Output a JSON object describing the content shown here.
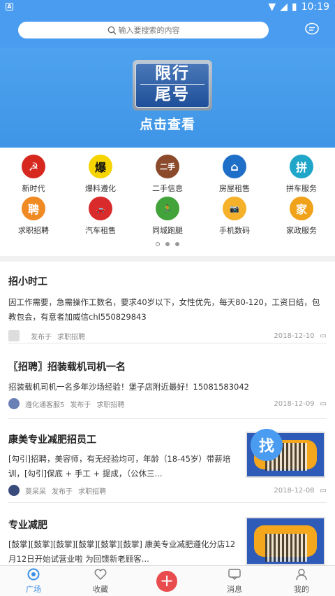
{
  "status": {
    "time": "10:19",
    "a": "A"
  },
  "search": {
    "placeholder": "输入要搜索的内容"
  },
  "banner": {
    "sign_top": "限行",
    "sign_bottom": "尾号",
    "cta": "点击查看"
  },
  "categories": [
    {
      "label": "新时代",
      "icon": "party-emblem-icon",
      "color": "#d6281f",
      "glyph": "☭"
    },
    {
      "label": "爆料遵化",
      "icon": "burst-icon",
      "color": "#f6d400",
      "glyph": "爆"
    },
    {
      "label": "二手信息",
      "icon": "secondhand-icon",
      "color": "#8b4a2b",
      "glyph": "二手"
    },
    {
      "label": "房屋租售",
      "icon": "house-icon",
      "color": "#1f6fc8",
      "glyph": "⌂"
    },
    {
      "label": "拼车服务",
      "icon": "carpool-icon",
      "color": "#1fa6c9",
      "glyph": "拼"
    },
    {
      "label": "求职招聘",
      "icon": "recruit-icon",
      "color": "#f08a23",
      "glyph": "聘"
    },
    {
      "label": "汽车租售",
      "icon": "car-icon",
      "color": "#d92b2b",
      "glyph": "🚗"
    },
    {
      "label": "同城跑腿",
      "icon": "runner-icon",
      "color": "#43a33b",
      "glyph": "🏃"
    },
    {
      "label": "手机数码",
      "icon": "camera-icon",
      "color": "#f5b12a",
      "glyph": "📷"
    },
    {
      "label": "家政服务",
      "icon": "housekeeping-icon",
      "color": "#f0a21a",
      "glyph": "家"
    }
  ],
  "posts": [
    {
      "title": "招小时工",
      "body": "因工作需要，急需操作工数名，要求40岁以下，女性优先，每天80-120，工资日结，包教包会，有意者加威信chl550829843",
      "author": "",
      "published": "发布于",
      "category": "求职招聘",
      "date": "2018-12-10"
    },
    {
      "title": "〖招聘〗招装载机司机一名",
      "body": "招装载机司机一名多年沙场经验！堡子店附近最好！15081583042",
      "author": "遵化通客服5",
      "published": "发布于",
      "category": "求职招聘",
      "date": "2018-12-09"
    },
    {
      "title": "康美专业减肥招员工",
      "body": "[勾引]招聘，美容师，有无经验均可，年龄（18-45岁）带薪培训，[勾引]保底 + 手工 + 提成，（公休三...",
      "author": "莫呆呆",
      "published": "发布于",
      "category": "求职招聘",
      "date": "2018-12-08"
    },
    {
      "title": "专业减肥",
      "body": "[鼓掌][鼓掌][鼓掌][鼓掌][鼓掌][鼓掌] 康美专业减肥遵化分店12月12日开始试营业啦 为回馈新老顾客..."
    }
  ],
  "fab": {
    "label": "找"
  },
  "tabs": [
    {
      "label": "广场",
      "icon": "square-icon"
    },
    {
      "label": "收藏",
      "icon": "heart-icon"
    },
    {
      "label": "",
      "icon": "plus-icon"
    },
    {
      "label": "消息",
      "icon": "message-icon"
    },
    {
      "label": "我的",
      "icon": "profile-icon"
    }
  ]
}
